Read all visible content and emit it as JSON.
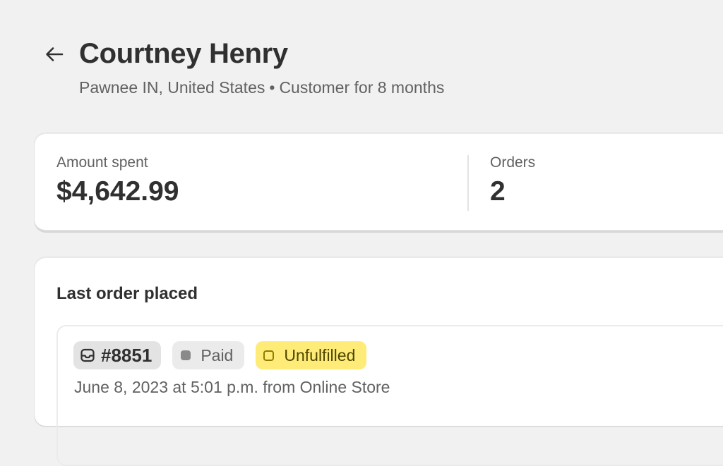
{
  "header": {
    "back_icon": "arrow-left-icon",
    "title": "Courtney Henry",
    "location": "Pawnee IN, United States",
    "separator": "•",
    "tenure": "Customer for 8 months"
  },
  "stats": {
    "amount_label": "Amount spent",
    "amount_value": "$4,642.99",
    "orders_label": "Orders",
    "orders_value": "2"
  },
  "last_order": {
    "section_title": "Last order placed",
    "order_icon": "order-tray-icon",
    "order_number": "#8851",
    "payment_status": "Paid",
    "fulfillment_status": "Unfulfilled",
    "meta": "June 8, 2023 at 5:01 p.m. from Online Store"
  },
  "colors": {
    "background": "#f1f1f1",
    "card": "#ffffff",
    "text_primary": "#303030",
    "text_secondary": "#616161",
    "unfulfilled_badge": "#ffeb78",
    "paid_badge": "#ebebeb"
  }
}
